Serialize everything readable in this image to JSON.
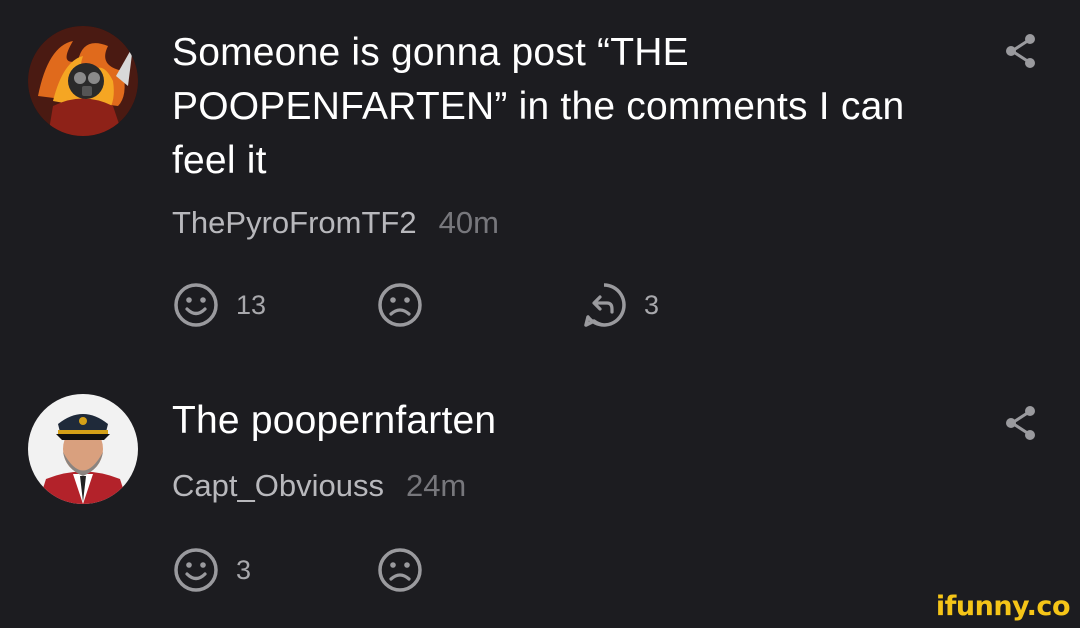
{
  "comments": [
    {
      "text": "Someone is gonna post “THE POOPENFARTEN” in the comments I can feel it",
      "username": "ThePyroFromTF2",
      "time": "40m",
      "likes": "13",
      "replies": "3"
    },
    {
      "text": "The poopernfarten",
      "username": "Capt_Obviouss",
      "time": "24m",
      "likes": "3"
    }
  ],
  "icons": {
    "share": "share-icon",
    "like": "smile-icon",
    "dislike": "frown-icon",
    "reply": "reply-icon"
  },
  "watermark": "ifunny.co",
  "colors": {
    "background": "#1c1c20",
    "text": "#ffffff",
    "username": "#b8b8bc",
    "time": "#77777c",
    "icon": "#9a9a9e",
    "watermark": "#f5c518"
  }
}
